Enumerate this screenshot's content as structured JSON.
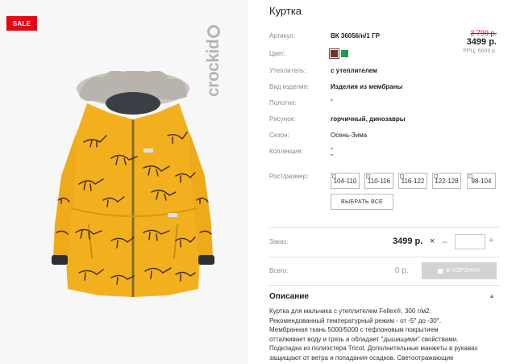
{
  "badge": "SALE",
  "brand": "crockid",
  "product": {
    "title": "Куртка",
    "article_label": "Артикул:",
    "article_value": "ВК 36056/н/1 ГР",
    "color_label": "Цвет:",
    "colors": [
      "#7b3226",
      "#1f9a54"
    ],
    "insulation_label": "Утеплитель:",
    "insulation_value": "с утеплителем",
    "type_label": "Вид изделия:",
    "type_value": "Изделия из мембраны",
    "fabric_label": "Полотно:",
    "fabric_value": "\"",
    "pattern_label": "Рисунок:",
    "pattern_value": "горчичный, динозавры",
    "season_label": "Сезон:",
    "season_value": "Осень-Зима",
    "collection_label": "Коллекция:",
    "collection_value_1": "\"",
    "collection_value_2": "\""
  },
  "price": {
    "old": "3 799 р.",
    "current": "3499 р.",
    "rrp": "РРЦ: 6699 р."
  },
  "sizes": {
    "label": "Рост/размер:",
    "options": [
      "104-110",
      "110-116",
      "116-122",
      "122-128",
      "98-104"
    ],
    "select_all": "ВЫБРАТЬ ВСЕ"
  },
  "order": {
    "label": "Заказ:",
    "price": "3499 р.",
    "times": "×",
    "minus": "–",
    "plus": "+",
    "quantity": ""
  },
  "total": {
    "label": "Всего:",
    "value": "0 р.",
    "cart_button": "В КОРЗИНУ"
  },
  "description": {
    "heading": "Описание",
    "caret": "▲",
    "lines": [
      "Куртка для мальчика с утеплителем Fellex®, 300 г/м2.",
      "Рекомендованный температурный режим - от -5° до -30°.",
      "Мембранная ткань 5000/5000 с тефлоновым покрытием",
      "отталкивает воду и грязь и обладает \"дышащими\" свойствами.",
      "Подкладка из полиэстера Tricot. Дополнительные манжеты в рукавах",
      "защищают от ветра и попадания осадков. Светоотражающие"
    ]
  }
}
